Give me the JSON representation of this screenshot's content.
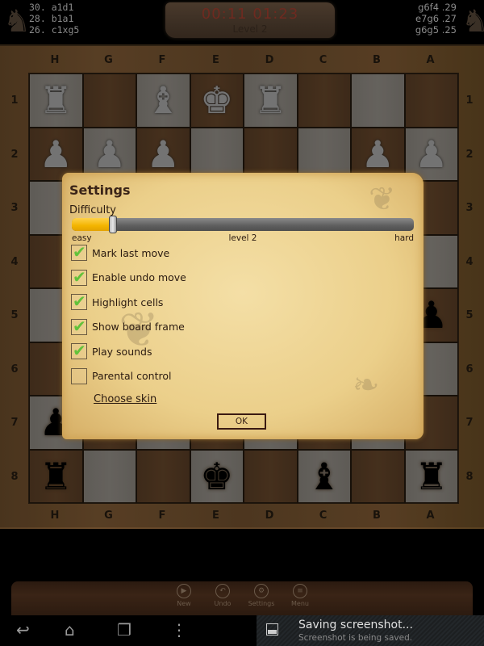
{
  "top_bar": {
    "left_moves": [
      "30. a1d1",
      "28. b1a1",
      "26. c1xg5"
    ],
    "right_moves": [
      "g6f4 .29",
      "e7g6 .27",
      "g6g5 .25"
    ],
    "timer": "00:11  01:23",
    "level": "Level 2",
    "left_knight_icon": "♞",
    "right_knight_icon": "♞"
  },
  "board": {
    "files_top": [
      "H",
      "G",
      "F",
      "E",
      "D",
      "C",
      "B",
      "A"
    ],
    "files_bottom": [
      "H",
      "G",
      "F",
      "E",
      "D",
      "C",
      "B",
      "A"
    ],
    "ranks": [
      "1",
      "2",
      "3",
      "4",
      "5",
      "6",
      "7",
      "8"
    ],
    "rows": [
      [
        {
          "piece": "♜",
          "color": "w"
        },
        {
          "piece": "",
          "color": ""
        },
        {
          "piece": "♝",
          "color": "w"
        },
        {
          "piece": "♚",
          "color": "w"
        },
        {
          "piece": "♜",
          "color": "w"
        },
        {
          "piece": "",
          "color": ""
        },
        {
          "piece": "",
          "color": ""
        },
        {
          "piece": "",
          "color": ""
        }
      ],
      [
        {
          "piece": "♟",
          "color": "w"
        },
        {
          "piece": "♟",
          "color": "w"
        },
        {
          "piece": "♟",
          "color": "w"
        },
        {
          "piece": "",
          "color": ""
        },
        {
          "piece": "",
          "color": ""
        },
        {
          "piece": "",
          "color": ""
        },
        {
          "piece": "♟",
          "color": "w"
        },
        {
          "piece": "♟",
          "color": "w"
        }
      ],
      [
        {
          "piece": "",
          "color": ""
        },
        {
          "piece": "",
          "color": ""
        },
        {
          "piece": "",
          "color": ""
        },
        {
          "piece": "",
          "color": ""
        },
        {
          "piece": "",
          "color": ""
        },
        {
          "piece": "",
          "color": ""
        },
        {
          "piece": "",
          "color": ""
        },
        {
          "piece": "",
          "color": ""
        }
      ],
      [
        {
          "piece": "",
          "color": ""
        },
        {
          "piece": "",
          "color": ""
        },
        {
          "piece": "",
          "color": ""
        },
        {
          "piece": "",
          "color": ""
        },
        {
          "piece": "",
          "color": ""
        },
        {
          "piece": "",
          "color": ""
        },
        {
          "piece": "",
          "color": ""
        },
        {
          "piece": "",
          "color": ""
        }
      ],
      [
        {
          "piece": "",
          "color": ""
        },
        {
          "piece": "",
          "color": ""
        },
        {
          "piece": "",
          "color": ""
        },
        {
          "piece": "",
          "color": ""
        },
        {
          "piece": "",
          "color": ""
        },
        {
          "piece": "",
          "color": ""
        },
        {
          "piece": "",
          "color": ""
        },
        {
          "piece": "♟",
          "color": "b"
        }
      ],
      [
        {
          "piece": "",
          "color": ""
        },
        {
          "piece": "",
          "color": ""
        },
        {
          "piece": "",
          "color": ""
        },
        {
          "piece": "",
          "color": ""
        },
        {
          "piece": "",
          "color": ""
        },
        {
          "piece": "",
          "color": ""
        },
        {
          "piece": "",
          "color": ""
        },
        {
          "piece": "",
          "color": ""
        }
      ],
      [
        {
          "piece": "♟",
          "color": "b"
        },
        {
          "piece": "",
          "color": ""
        },
        {
          "piece": "",
          "color": ""
        },
        {
          "piece": "",
          "color": ""
        },
        {
          "piece": "",
          "color": ""
        },
        {
          "piece": "",
          "color": ""
        },
        {
          "piece": "",
          "color": ""
        },
        {
          "piece": "",
          "color": ""
        }
      ],
      [
        {
          "piece": "♜",
          "color": "b"
        },
        {
          "piece": "",
          "color": ""
        },
        {
          "piece": "",
          "color": ""
        },
        {
          "piece": "♚",
          "color": "b"
        },
        {
          "piece": "",
          "color": ""
        },
        {
          "piece": "♝",
          "color": "b"
        },
        {
          "piece": "",
          "color": ""
        },
        {
          "piece": "♜",
          "color": "b"
        }
      ]
    ]
  },
  "settings_dialog": {
    "title": "Settings",
    "difficulty_label": "Difficulty",
    "difficulty": {
      "min_label": "easy",
      "max_label": "hard",
      "current_label": "level 2",
      "fraction": 0.12
    },
    "options": [
      {
        "label": "Mark last move",
        "checked": true
      },
      {
        "label": "Enable undo move",
        "checked": true
      },
      {
        "label": "Highlight cells",
        "checked": true
      },
      {
        "label": "Show board frame",
        "checked": true
      },
      {
        "label": "Play sounds",
        "checked": true
      },
      {
        "label": "Parental control",
        "checked": false
      }
    ],
    "check_glyph": "✔",
    "choose_skin_link": "Choose skin",
    "ok_label": "OK"
  },
  "toolbar": {
    "buttons": [
      {
        "label": "New",
        "icon": "▶"
      },
      {
        "label": "Undo",
        "icon": "↶"
      },
      {
        "label": "Settings",
        "icon": "⚙"
      },
      {
        "label": "Menu",
        "icon": "≡"
      }
    ]
  },
  "nav_bar": {
    "back_icon": "↩",
    "home_icon": "⌂",
    "recents_icon": "❐",
    "overflow_icon": "⋮"
  },
  "notification": {
    "title": "Saving screenshot...",
    "subtitle": "Screenshot is being saved."
  },
  "colors": {
    "slider_accent": "#f3b400",
    "checkmark": "#62c23a",
    "parchment": "#f0d89a"
  }
}
